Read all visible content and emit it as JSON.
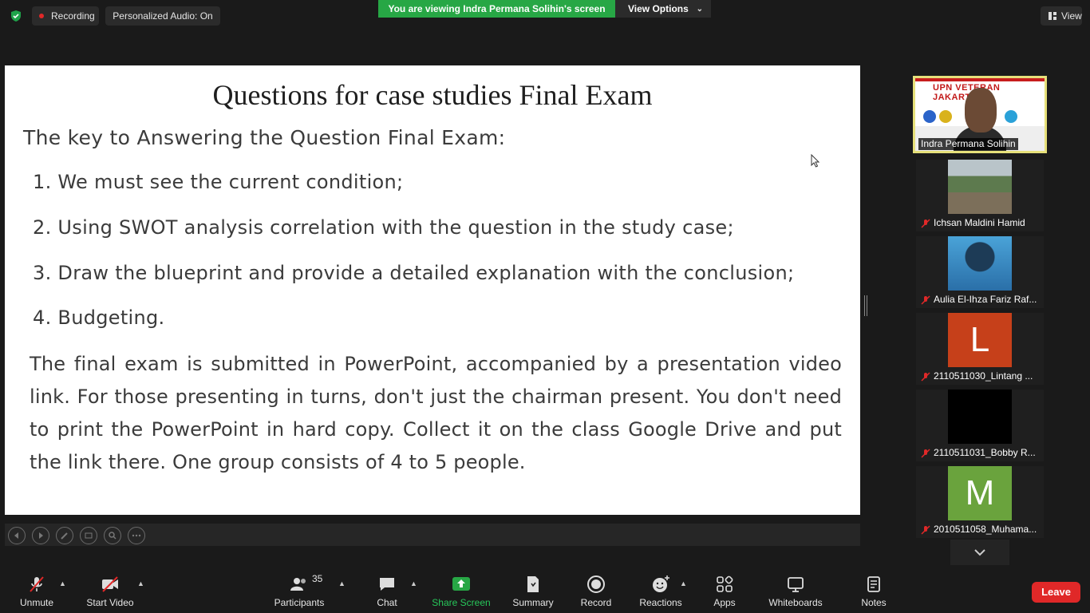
{
  "top": {
    "recording": "Recording",
    "audio": "Personalized Audio: On",
    "banner": "You are viewing Indra Permana Solihin's screen",
    "view_options": "View Options",
    "view": "View"
  },
  "slide": {
    "title": "Questions for case studies Final Exam",
    "subtitle": "The key to Answering the Question Final Exam:",
    "items": [
      "1. We must see the current condition;",
      "2. Using SWOT analysis correlation with the question in the study case;",
      "3. Draw the blueprint and provide a detailed explanation with the conclusion;",
      "4. Budgeting."
    ],
    "paragraph": "The final exam is submitted in PowerPoint, accompanied by a presentation video link. For those presenting in turns, don't just the chairman present. You don't need to print the PowerPoint in hard copy. Collect it on the class Google Drive and put the link there. One group consists of 4 to 5 people."
  },
  "active_speaker": {
    "name": "Indra Permana Solihin",
    "banner_text": "UPN VETERAN JAKARTA"
  },
  "participants": [
    {
      "name": "Ichsan Maldini Hamid",
      "muted": true
    },
    {
      "name": "Aulia El-Ihza Fariz Raf...",
      "muted": true
    },
    {
      "name": "2110511030_Lintang ...",
      "muted": true,
      "initial": "L",
      "color": "#c6401a"
    },
    {
      "name": "2110511031_Bobby R...",
      "muted": true
    },
    {
      "name": "2010511058_Muhama...",
      "muted": true,
      "initial": "M",
      "color": "#6aa33d"
    }
  ],
  "toolbar": {
    "unmute": "Unmute",
    "start_video": "Start Video",
    "participants": "Participants",
    "participants_count": "35",
    "chat": "Chat",
    "share_screen": "Share Screen",
    "summary": "Summary",
    "record": "Record",
    "reactions": "Reactions",
    "apps": "Apps",
    "whiteboards": "Whiteboards",
    "notes": "Notes",
    "leave": "Leave"
  },
  "colors": {
    "share_green": "#27a745",
    "leave_red": "#e02828",
    "speaker_border": "#e6e07a"
  }
}
